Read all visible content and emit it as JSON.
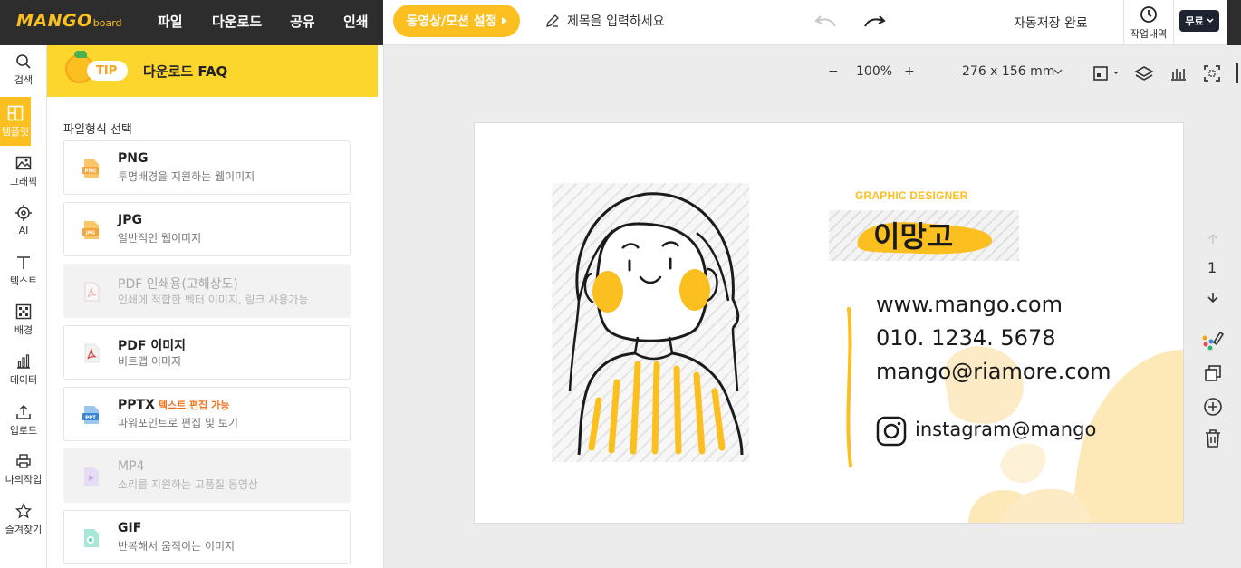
{
  "header": {
    "logo": "MANGO",
    "logo_sub": "board",
    "menu": [
      "파일",
      "다운로드",
      "공유",
      "인쇄"
    ],
    "motion_button": "동영상/모션 설정",
    "title_placeholder": "제목을 입력하세요",
    "autosave": "자동저장 완료",
    "history_label": "작업내역",
    "plan_label": "무료"
  },
  "rail": [
    {
      "label": "검색",
      "icon": "search-icon"
    },
    {
      "label": "템플릿",
      "icon": "template-icon"
    },
    {
      "label": "그래픽",
      "icon": "image-icon"
    },
    {
      "label": "AI",
      "icon": "ai-icon"
    },
    {
      "label": "텍스트",
      "icon": "text-icon"
    },
    {
      "label": "배경",
      "icon": "background-icon"
    },
    {
      "label": "데이터",
      "icon": "chart-icon"
    },
    {
      "label": "업로드",
      "icon": "upload-icon"
    },
    {
      "label": "나의작업",
      "icon": "printer-icon"
    },
    {
      "label": "즐겨찾기",
      "icon": "star-icon"
    }
  ],
  "panel": {
    "tip_badge": "TIP",
    "tip_title": "다운로드 FAQ",
    "section_label": "파일형식 선택",
    "formats": [
      {
        "name": "PNG",
        "desc": "투명배경을 지원하는 웹이미지",
        "icon": "png-file-icon",
        "enabled": true,
        "tag": ""
      },
      {
        "name": "JPG",
        "desc": "일반적인 웹이미지",
        "icon": "jpg-file-icon",
        "enabled": true,
        "tag": ""
      },
      {
        "name": "PDF 인쇄용(고해상도)",
        "desc": "인쇄에 적합한 벡터 이미지, 링크 사용가능",
        "icon": "pdf-icon",
        "enabled": false,
        "tag": ""
      },
      {
        "name": "PDF 이미지",
        "desc": "비트맵 이미지",
        "icon": "pdf-icon",
        "enabled": true,
        "tag": ""
      },
      {
        "name": "PPTX",
        "desc": "파워포인트로 편집 및 보기",
        "icon": "ppt-file-icon",
        "enabled": true,
        "tag": "텍스트 편집 가능"
      },
      {
        "name": "MP4",
        "desc": "소리를 지원하는 고품질 동영상",
        "icon": "video-file-icon",
        "enabled": false,
        "tag": ""
      },
      {
        "name": "GIF",
        "desc": "반복해서 움직이는 이미지",
        "icon": "gif-file-icon",
        "enabled": true,
        "tag": ""
      }
    ]
  },
  "canvas_toolbar": {
    "zoom_minus": "−",
    "zoom": "100%",
    "zoom_plus": "+",
    "size": "276 x 156 mm"
  },
  "card": {
    "role": "GRAPHIC DESIGNER",
    "name": "이망고",
    "website": "www.mango.com",
    "phone": "010. 1234. 5678",
    "email": "mango@riamore.com",
    "instagram": "instagram@mango",
    "accent": "#fbbf1f"
  },
  "page_nav": {
    "page": "1"
  },
  "colors": {
    "brand": "#fbbf1f",
    "dark": "#2d2d2d",
    "tip_bg": "#fcd62d"
  }
}
